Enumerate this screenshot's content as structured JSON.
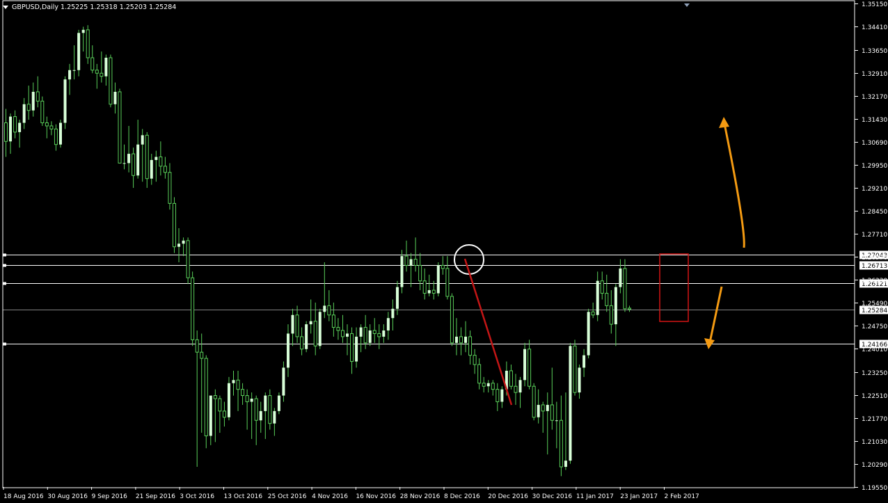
{
  "chart": {
    "symbol": "GBPUSD",
    "timeframe": "Daily",
    "ohlc": [
      "1.25225",
      "1.25318",
      "1.25203",
      "1.25284"
    ],
    "colors": {
      "background": "#000000",
      "bull": "#d8ffd8",
      "wick": "#5ad15a",
      "axis": "#ffffff",
      "hline": "#ffffff",
      "current_line": "#b0b0b0",
      "trend_line": "#c41616",
      "box": "#d41414",
      "arrow": "#f59b12",
      "circle": "#ffffff"
    }
  },
  "chart_data": {
    "type": "candlestick",
    "y_range": [
      1.1955,
      1.3515
    ],
    "y_ticks": [
      "1.35150",
      "1.34410",
      "1.33650",
      "1.32910",
      "1.32170",
      "1.31430",
      "1.30690",
      "1.29950",
      "1.29210",
      "1.28450",
      "1.27710",
      "1.26970",
      "1.26230",
      "1.25490",
      "1.24750",
      "1.24010",
      "1.23250",
      "1.22510",
      "1.21770",
      "1.21030",
      "1.20290",
      "1.19550"
    ],
    "x_labels": [
      "18 Aug 2016",
      "30 Aug 2016",
      "9 Sep 2016",
      "21 Sep 2016",
      "3 Oct 2016",
      "13 Oct 2016",
      "25 Oct 2016",
      "4 Nov 2016",
      "16 Nov 2016",
      "28 Nov 2016",
      "8 Dec 2016",
      "20 Dec 2016",
      "30 Dec 2016",
      "11 Jan 2017",
      "23 Jan 2017",
      "2 Feb 2017"
    ],
    "horizontal_levels": [
      {
        "value": 1.27043,
        "label": "1.27043"
      },
      {
        "value": 1.26713,
        "label": "1.26713"
      },
      {
        "value": 1.26121,
        "label": "1.26121"
      },
      {
        "value": 1.25284,
        "label": "1.25284",
        "current": true
      },
      {
        "value": 1.24166,
        "label": "1.24166"
      }
    ],
    "candles": [
      [
        1.313,
        1.3175,
        1.302,
        1.307
      ],
      [
        1.307,
        1.316,
        1.303,
        1.315
      ],
      [
        1.315,
        1.317,
        1.308,
        1.31
      ],
      [
        1.31,
        1.314,
        1.305,
        1.313
      ],
      [
        1.313,
        1.321,
        1.311,
        1.319
      ],
      [
        1.319,
        1.325,
        1.314,
        1.317
      ],
      [
        1.317,
        1.326,
        1.315,
        1.323
      ],
      [
        1.323,
        1.328,
        1.318,
        1.32
      ],
      [
        1.32,
        1.3215,
        1.312,
        1.313
      ],
      [
        1.313,
        1.315,
        1.308,
        1.312
      ],
      [
        1.312,
        1.3135,
        1.309,
        1.311
      ],
      [
        1.311,
        1.3125,
        1.304,
        1.306
      ],
      [
        1.306,
        1.314,
        1.305,
        1.313
      ],
      [
        1.313,
        1.328,
        1.311,
        1.327
      ],
      [
        1.327,
        1.332,
        1.322,
        1.33
      ],
      [
        1.33,
        1.338,
        1.327,
        1.33
      ],
      [
        1.33,
        1.343,
        1.328,
        1.342
      ],
      [
        1.342,
        1.344,
        1.336,
        1.343
      ],
      [
        1.343,
        1.3445,
        1.332,
        1.334
      ],
      [
        1.334,
        1.338,
        1.329,
        1.33
      ],
      [
        1.33,
        1.332,
        1.324,
        1.329
      ],
      [
        1.329,
        1.336,
        1.326,
        1.328
      ],
      [
        1.328,
        1.335,
        1.325,
        1.334
      ],
      [
        1.334,
        1.335,
        1.318,
        1.319
      ],
      [
        1.319,
        1.326,
        1.316,
        1.323
      ],
      [
        1.323,
        1.324,
        1.304,
        1.3
      ],
      [
        1.3,
        1.306,
        1.298,
        1.3
      ],
      [
        1.3,
        1.312,
        1.297,
        1.303
      ],
      [
        1.303,
        1.305,
        1.292,
        1.296
      ],
      [
        1.296,
        1.314,
        1.295,
        1.306
      ],
      [
        1.306,
        1.311,
        1.294,
        1.309
      ],
      [
        1.309,
        1.31,
        1.292,
        1.295
      ],
      [
        1.295,
        1.303,
        1.293,
        1.301
      ],
      [
        1.301,
        1.304,
        1.294,
        1.302
      ],
      [
        1.302,
        1.307,
        1.296,
        1.299
      ],
      [
        1.299,
        1.302,
        1.295,
        1.297
      ],
      [
        1.297,
        1.3,
        1.285,
        1.287
      ],
      [
        1.287,
        1.289,
        1.271,
        1.273
      ],
      [
        1.273,
        1.279,
        1.268,
        1.274
      ],
      [
        1.274,
        1.276,
        1.27,
        1.275
      ],
      [
        1.275,
        1.276,
        1.261,
        1.263
      ],
      [
        1.263,
        1.265,
        1.241,
        1.243
      ],
      [
        1.243,
        1.246,
        1.202,
        1.239
      ],
      [
        1.239,
        1.245,
        1.213,
        1.237
      ],
      [
        1.237,
        1.238,
        1.208,
        1.212
      ],
      [
        1.212,
        1.214,
        1.209,
        1.225
      ],
      [
        1.225,
        1.227,
        1.21,
        1.224
      ],
      [
        1.224,
        1.225,
        1.213,
        1.22
      ],
      [
        1.22,
        1.223,
        1.215,
        1.218
      ],
      [
        1.218,
        1.231,
        1.217,
        1.229
      ],
      [
        1.229,
        1.233,
        1.225,
        1.23
      ],
      [
        1.23,
        1.233,
        1.22,
        1.227
      ],
      [
        1.227,
        1.229,
        1.222,
        1.225
      ],
      [
        1.225,
        1.227,
        1.214,
        1.223
      ],
      [
        1.223,
        1.226,
        1.211,
        1.224
      ],
      [
        1.224,
        1.225,
        1.209,
        1.217
      ],
      [
        1.217,
        1.223,
        1.213,
        1.22
      ],
      [
        1.22,
        1.226,
        1.211,
        1.225
      ],
      [
        1.225,
        1.227,
        1.214,
        1.216
      ],
      [
        1.216,
        1.221,
        1.212,
        1.22
      ],
      [
        1.22,
        1.226,
        1.219,
        1.225
      ],
      [
        1.225,
        1.236,
        1.223,
        1.234
      ],
      [
        1.234,
        1.248,
        1.231,
        1.245
      ],
      [
        1.245,
        1.253,
        1.241,
        1.251
      ],
      [
        1.251,
        1.254,
        1.242,
        1.244
      ],
      [
        1.244,
        1.247,
        1.238,
        1.24
      ],
      [
        1.24,
        1.249,
        1.239,
        1.248
      ],
      [
        1.248,
        1.256,
        1.245,
        1.249
      ],
      [
        1.249,
        1.255,
        1.238,
        1.241
      ],
      [
        1.241,
        1.253,
        1.24,
        1.252
      ],
      [
        1.252,
        1.268,
        1.25,
        1.254
      ],
      [
        1.254,
        1.259,
        1.249,
        1.251
      ],
      [
        1.251,
        1.255,
        1.244,
        1.247
      ],
      [
        1.247,
        1.25,
        1.243,
        1.246
      ],
      [
        1.246,
        1.251,
        1.242,
        1.244
      ],
      [
        1.244,
        1.248,
        1.238,
        1.245
      ],
      [
        1.245,
        1.247,
        1.232,
        1.236
      ],
      [
        1.236,
        1.247,
        1.234,
        1.244
      ],
      [
        1.244,
        1.248,
        1.239,
        1.247
      ],
      [
        1.247,
        1.251,
        1.24,
        1.242
      ],
      [
        1.242,
        1.248,
        1.241,
        1.246
      ],
      [
        1.246,
        1.25,
        1.242,
        1.245
      ],
      [
        1.245,
        1.248,
        1.24,
        1.244
      ],
      [
        1.244,
        1.248,
        1.242,
        1.246
      ],
      [
        1.246,
        1.252,
        1.243,
        1.25
      ],
      [
        1.25,
        1.256,
        1.246,
        1.253
      ],
      [
        1.253,
        1.262,
        1.251,
        1.26
      ],
      [
        1.26,
        1.272,
        1.258,
        1.27
      ],
      [
        1.27,
        1.275,
        1.265,
        1.267
      ],
      [
        1.267,
        1.271,
        1.26,
        1.269
      ],
      [
        1.269,
        1.276,
        1.265,
        1.267
      ],
      [
        1.267,
        1.271,
        1.259,
        1.262
      ],
      [
        1.262,
        1.266,
        1.256,
        1.258
      ],
      [
        1.258,
        1.264,
        1.257,
        1.259
      ],
      [
        1.259,
        1.262,
        1.256,
        1.258
      ],
      [
        1.258,
        1.268,
        1.257,
        1.267
      ],
      [
        1.267,
        1.27,
        1.264,
        1.266
      ],
      [
        1.266,
        1.27,
        1.256,
        1.257
      ],
      [
        1.257,
        1.258,
        1.241,
        1.242
      ],
      [
        1.242,
        1.25,
        1.238,
        1.244
      ],
      [
        1.244,
        1.247,
        1.238,
        1.242
      ],
      [
        1.242,
        1.249,
        1.239,
        1.244
      ],
      [
        1.244,
        1.246,
        1.235,
        1.238
      ],
      [
        1.238,
        1.24,
        1.232,
        1.235
      ],
      [
        1.235,
        1.237,
        1.227,
        1.229
      ],
      [
        1.229,
        1.231,
        1.226,
        1.228
      ],
      [
        1.228,
        1.23,
        1.226,
        1.229
      ],
      [
        1.229,
        1.23,
        1.225,
        1.227
      ],
      [
        1.227,
        1.229,
        1.22,
        1.223
      ],
      [
        1.223,
        1.228,
        1.221,
        1.227
      ],
      [
        1.227,
        1.236,
        1.225,
        1.233
      ],
      [
        1.233,
        1.235,
        1.227,
        1.228
      ],
      [
        1.228,
        1.232,
        1.222,
        1.226
      ],
      [
        1.226,
        1.231,
        1.221,
        1.23
      ],
      [
        1.23,
        1.242,
        1.228,
        1.24
      ],
      [
        1.24,
        1.243,
        1.227,
        1.228
      ],
      [
        1.228,
        1.229,
        1.217,
        1.218
      ],
      [
        1.218,
        1.227,
        1.216,
        1.222
      ],
      [
        1.222,
        1.223,
        1.213,
        1.22
      ],
      [
        1.22,
        1.226,
        1.206,
        1.222
      ],
      [
        1.222,
        1.234,
        1.214,
        1.217
      ],
      [
        1.217,
        1.223,
        1.208,
        1.217
      ],
      [
        1.217,
        1.225,
        1.199,
        1.202
      ],
      [
        1.202,
        1.226,
        1.201,
        1.204
      ],
      [
        1.204,
        1.242,
        1.203,
        1.241
      ],
      [
        1.241,
        1.243,
        1.225,
        1.226
      ],
      [
        1.226,
        1.235,
        1.224,
        1.234
      ],
      [
        1.234,
        1.24,
        1.231,
        1.238
      ],
      [
        1.238,
        1.253,
        1.237,
        1.252
      ],
      [
        1.252,
        1.255,
        1.25,
        1.251
      ],
      [
        1.251,
        1.265,
        1.249,
        1.262
      ],
      [
        1.262,
        1.265,
        1.256,
        1.258
      ],
      [
        1.258,
        1.264,
        1.252,
        1.254
      ],
      [
        1.254,
        1.259,
        1.245,
        1.248
      ],
      [
        1.248,
        1.261,
        1.241,
        1.26
      ],
      [
        1.26,
        1.269,
        1.258,
        1.266
      ],
      [
        1.266,
        1.269,
        1.252,
        1.253
      ],
      [
        1.2532,
        1.254,
        1.252,
        1.2528
      ]
    ]
  }
}
